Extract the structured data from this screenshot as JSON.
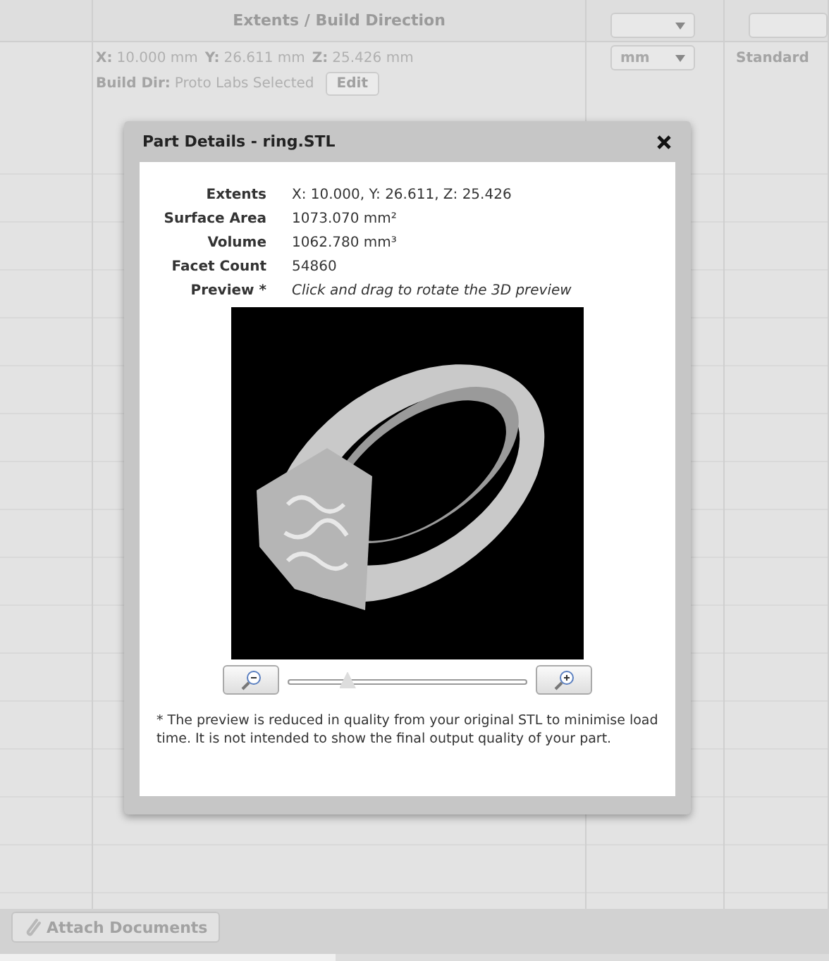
{
  "table": {
    "column_heading": "Extents / Build Direction",
    "row": {
      "extents": [
        {
          "axis": "X:",
          "value": "10.000 mm"
        },
        {
          "axis": "Y:",
          "value": "26.611 mm"
        },
        {
          "axis": "Z:",
          "value": "25.426 mm"
        }
      ],
      "build_dir_label": "Build Dir:",
      "build_dir_value": "Proto Labs Selected",
      "edit_button": "Edit",
      "units": "mm",
      "material": "Standard"
    }
  },
  "dialog": {
    "title": "Part Details - ring.STL",
    "fields": [
      {
        "label": "Extents",
        "value": "X: 10.000, Y: 26.611, Z: 25.426",
        "kind": "value"
      },
      {
        "label": "Surface Area",
        "value": "1073.070 mm²",
        "kind": "value"
      },
      {
        "label": "Volume",
        "value": "1062.780 mm³",
        "kind": "value"
      },
      {
        "label": "Facet Count",
        "value": "54860",
        "kind": "value"
      },
      {
        "label": "Preview *",
        "value": "Click and drag to rotate the 3D preview",
        "kind": "hint"
      }
    ],
    "zoom": {
      "level": 0.25
    },
    "footnote": "* The preview is reduced in quality from your original STL to minimise load time.  It is not intended to show the final output quality of your part."
  },
  "attach_button": "Attach Documents"
}
